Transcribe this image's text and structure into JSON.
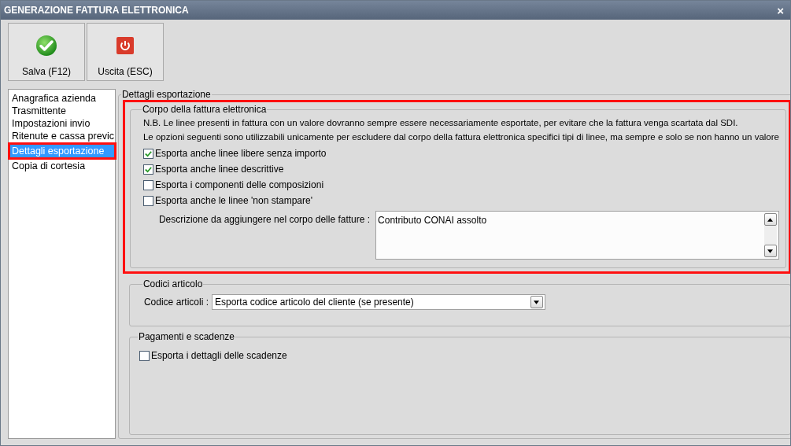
{
  "window": {
    "title": "GENERAZIONE FATTURA ELETTRONICA",
    "close": "×"
  },
  "toolbar": [
    {
      "kind": "save",
      "label": "Salva (F12)"
    },
    {
      "kind": "exit",
      "label": "Uscita (ESC)"
    }
  ],
  "sidebar": {
    "items": [
      {
        "label": "Anagrafica azienda",
        "selected": false,
        "highlighted": false
      },
      {
        "label": "Trasmittente",
        "selected": false,
        "highlighted": false
      },
      {
        "label": "Impostazioni invio",
        "selected": false,
        "highlighted": false
      },
      {
        "label": "Ritenute e cassa previc",
        "selected": false,
        "highlighted": false
      },
      {
        "label": "Dettagli esportazione",
        "selected": true,
        "highlighted": true
      },
      {
        "label": "Copia di cortesia",
        "selected": false,
        "highlighted": false
      }
    ]
  },
  "panel": {
    "title": "Dettagli esportazione",
    "body_group": {
      "title": "Corpo della fattura elettronica",
      "highlighted": true,
      "notes": [
        "N.B. Le linee presenti in fattura con un valore dovranno sempre essere necessariamente esportate, per evitare che la fattura venga scartata dal SDI.",
        "Le opzioni seguenti sono utilizzabili unicamente per escludere dal corpo della fattura elettronica specifici tipi di linee, ma sempre e solo se non hanno un valore"
      ],
      "options": [
        {
          "label": "Esporta anche linee libere senza importo",
          "checked": true
        },
        {
          "label": "Esporta anche linee descrittive",
          "checked": true
        },
        {
          "label": "Esporta i componenti delle composizioni",
          "checked": false
        },
        {
          "label": "Esporta anche le linee 'non stampare'",
          "checked": false
        }
      ],
      "description_label": "Descrizione da aggiungere nel corpo delle fatture :",
      "description_value": "Contributo CONAI assolto"
    },
    "codes_group": {
      "title": "Codici articolo",
      "field_label": "Codice articoli :",
      "field_value": "Esporta codice articolo del cliente (se presente)"
    },
    "payments_group": {
      "title": "Pagamenti e scadenze",
      "options": [
        {
          "label": "Esporta i dettagli delle scadenze",
          "checked": false
        }
      ]
    }
  }
}
